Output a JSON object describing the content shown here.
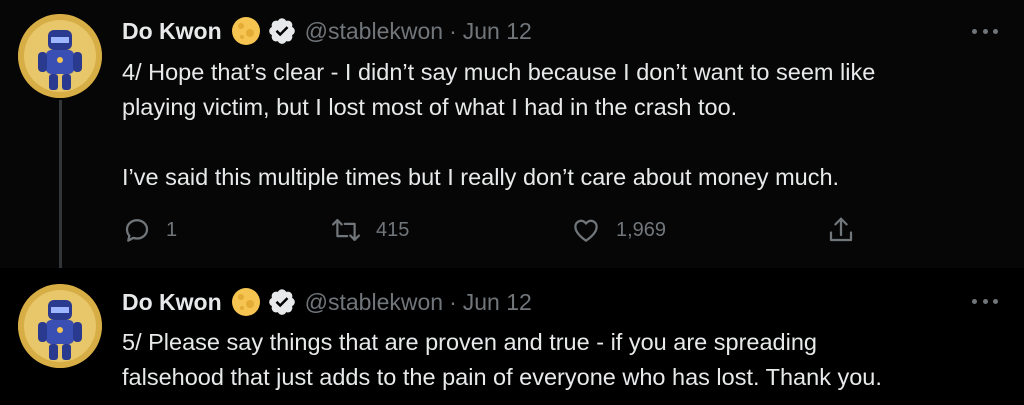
{
  "tweets": [
    {
      "author": {
        "name": "Do Kwon",
        "handle": "@stablekwon",
        "date": "Jun 12"
      },
      "lines": [
        "4/ Hope that’s clear - I didn’t say much because I don’t want to seem like",
        "playing victim, but I lost most of what I had in the crash too.",
        "",
        "I’ve said this multiple times but I really don’t care about money much."
      ],
      "stats": {
        "replies": "1",
        "retweets": "415",
        "likes": "1,969"
      }
    },
    {
      "author": {
        "name": "Do Kwon",
        "handle": "@stablekwon",
        "date": "Jun 12"
      },
      "lines": [
        "5/ Please say things that are proven and true - if you are spreading",
        "falsehood that just adds to the pain of everyone who has lost. Thank you."
      ]
    }
  ],
  "separator": "·",
  "icons": {
    "badge": "full-moon-icon",
    "verified": "verified-badge-icon",
    "more": "more-horizontal-icon",
    "reply": "reply-icon",
    "retweet": "retweet-icon",
    "like": "heart-icon",
    "share": "share-icon"
  },
  "colors": {
    "text": "#e7e9ea",
    "muted": "#71767b",
    "background": "#000000",
    "moon": "#f5c451"
  }
}
